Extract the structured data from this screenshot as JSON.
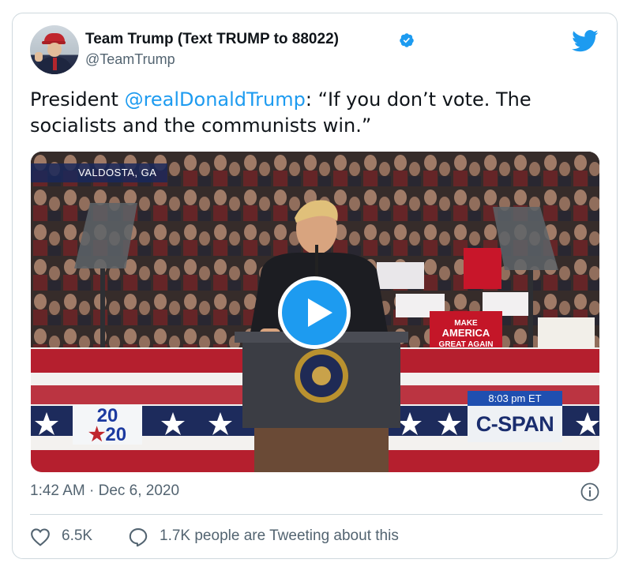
{
  "author": {
    "display_name": "Team Trump (Text TRUMP to 88022)",
    "handle": "@TeamTrump",
    "verified": true,
    "avatar_icon": "profile-photo-avatar"
  },
  "tweet": {
    "text_prefix": "President ",
    "mention": "@realDonaldTrump",
    "text_suffix": ": “If you don’t vote. The socialists and the communists win.”"
  },
  "media": {
    "type": "video",
    "location_overlay": "VALDOSTA, GA",
    "time_overlay": "8:03 pm ET",
    "network_overlay": "C-SPAN",
    "logo_line1": "20",
    "logo_line2": "20",
    "play_icon": "play-icon",
    "sign_make_america": "MAKE AMERICA GREAT AGAIN"
  },
  "timestamp": "1:42 AM · Dec 6, 2020",
  "actions": {
    "likes": "6.5K",
    "tweeting_text": "1.7K people are Tweeting about this"
  },
  "colors": {
    "accent": "#1d9bf0",
    "text": "#0f1419",
    "muted": "#536471",
    "border": "#cfd9de"
  }
}
